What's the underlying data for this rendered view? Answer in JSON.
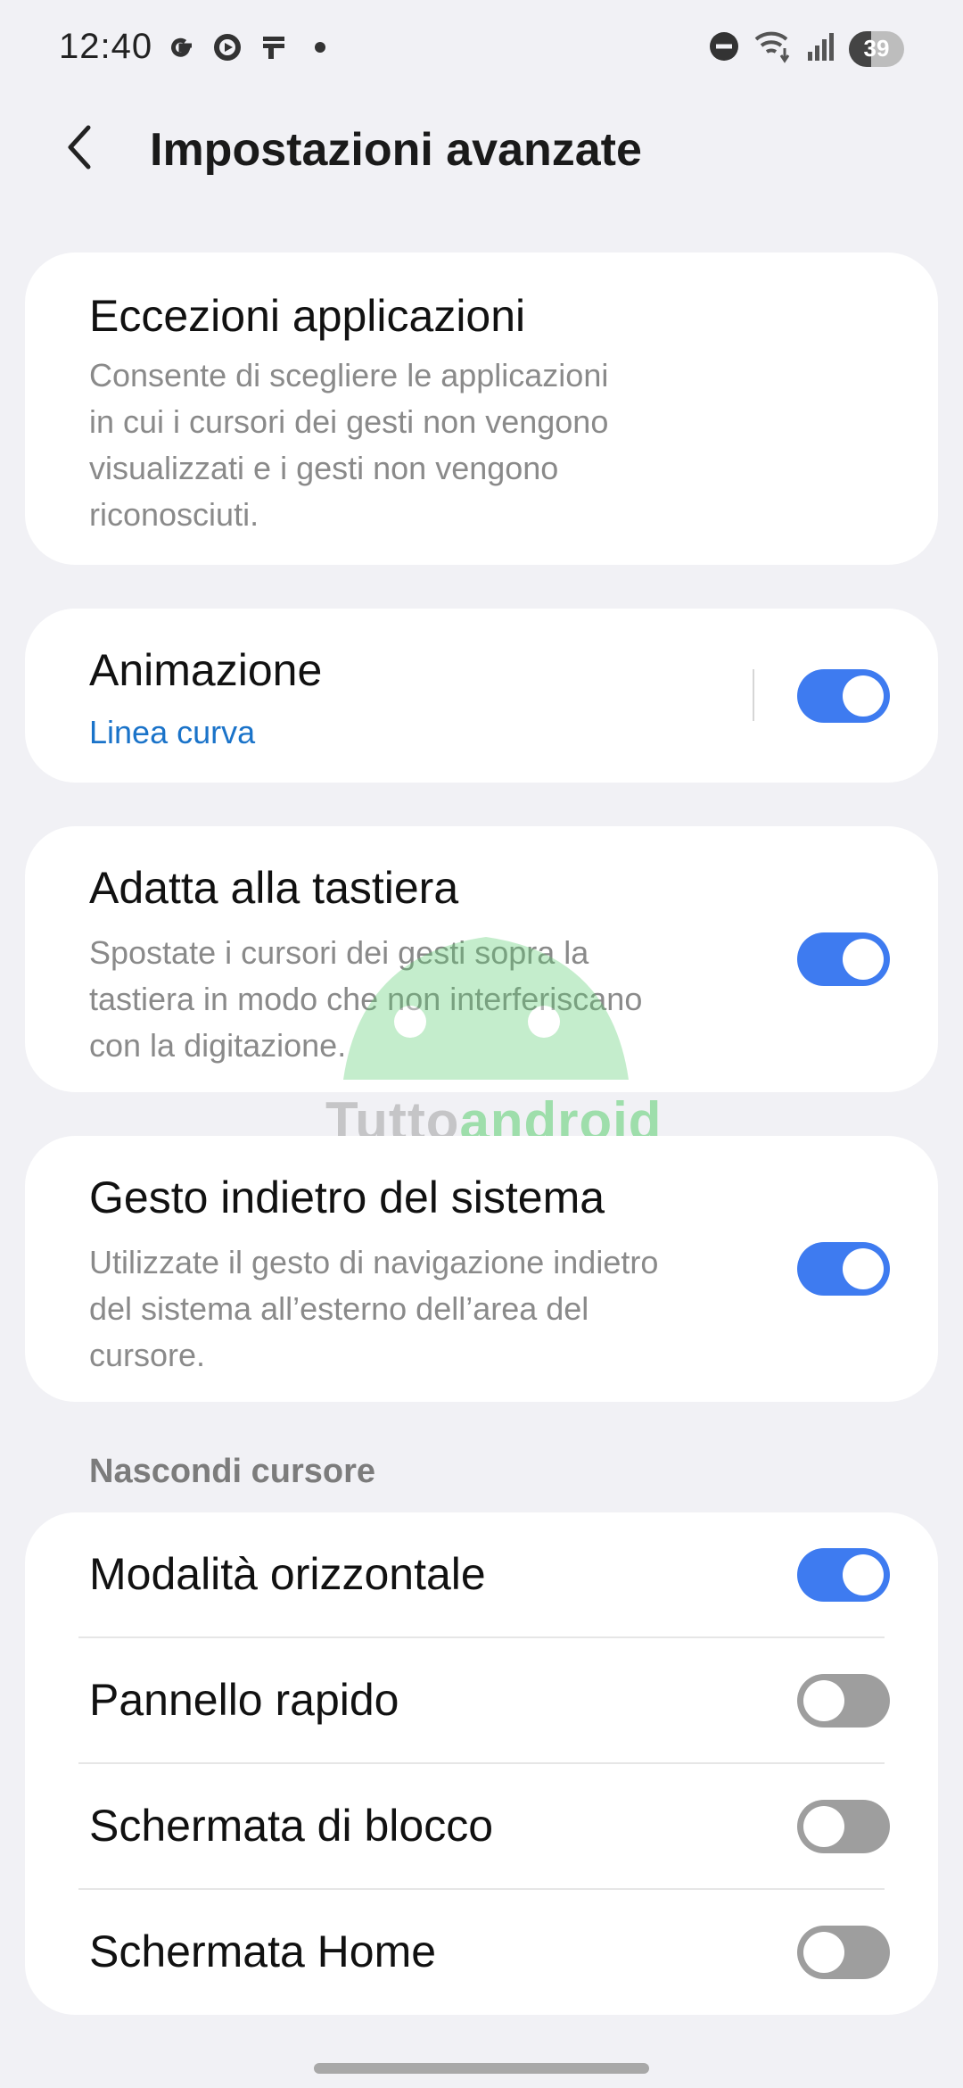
{
  "status_bar": {
    "time": "12:40",
    "battery_level": "39",
    "left_icons": [
      "google-icon",
      "record-icon",
      "parking-icon",
      "dot-icon"
    ],
    "right_icons": [
      "dnd-icon",
      "wifi-calling-icon",
      "signal-icon",
      "battery-icon"
    ]
  },
  "header": {
    "back_icon": "back-chevron-icon",
    "title": "Impostazioni avanzate"
  },
  "items": {
    "app_exceptions": {
      "title": "Eccezioni applicazioni",
      "desc": [
        "Consente di scegliere le applicazioni",
        "in cui i cursori dei gesti non vengono",
        "visualizzati e i gesti non vengono",
        "riconosciuti."
      ]
    },
    "animation": {
      "title": "Animazione",
      "value": "Linea curva",
      "enabled": true
    },
    "keyboard_adapt": {
      "title": "Adatta alla tastiera",
      "desc": [
        "Spostate i cursori dei gesti sopra la",
        "tastiera in modo che non interferiscano",
        "con la digitazione."
      ],
      "enabled": true
    },
    "system_back": {
      "title": "Gesto indietro del sistema",
      "desc": [
        "Utilizzate il gesto di navigazione indietro",
        "del sistema all’esterno dell’area del",
        "cursore."
      ],
      "enabled": true
    }
  },
  "hide_cursor": {
    "label": "Nascondi cursore",
    "rows": [
      {
        "title": "Modalità orizzontale",
        "enabled": true
      },
      {
        "title": "Pannello rapido",
        "enabled": false
      },
      {
        "title": "Schermata di blocco",
        "enabled": false
      },
      {
        "title": "Schermata Home",
        "enabled": false
      }
    ]
  },
  "watermark": {
    "text_grey": "Tutto",
    "text_green": "android"
  },
  "colors": {
    "accent": "#3e7bf0",
    "link": "#1a73c9",
    "background": "#f1f1f5"
  }
}
